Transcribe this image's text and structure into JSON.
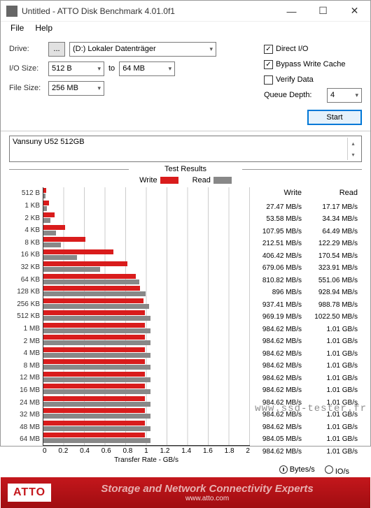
{
  "window": {
    "title": "Untitled - ATTO Disk Benchmark 4.01.0f1"
  },
  "menu": {
    "file": "File",
    "help": "Help"
  },
  "controls": {
    "drive_label": "Drive:",
    "drive_browse": "...",
    "drive_value": "(D:) Lokaler Datenträger",
    "io_label": "I/O Size:",
    "io_from": "512 B",
    "io_to_label": "to",
    "io_to": "64 MB",
    "file_label": "File Size:",
    "file_value": "256 MB",
    "direct_io": "Direct I/O",
    "bypass": "Bypass Write Cache",
    "verify": "Verify Data",
    "queue_label": "Queue Depth:",
    "queue_value": "4",
    "start": "Start"
  },
  "device": "Vansuny U52 512GB",
  "results": {
    "header": "Test Results",
    "legend_write": "Write",
    "legend_read": "Read",
    "col_write": "Write",
    "col_read": "Read",
    "xlabel": "Transfer Rate - GB/s",
    "bytes": "Bytes/s",
    "ios": "IO/s"
  },
  "chart_data": {
    "type": "bar",
    "xlabel": "Transfer Rate - GB/s",
    "xlim": [
      0,
      2
    ],
    "xticks": [
      0,
      0.2,
      0.4,
      0.6,
      0.8,
      1,
      1.2,
      1.4,
      1.6,
      1.8,
      2
    ],
    "categories": [
      "512 B",
      "1 KB",
      "2 KB",
      "4 KB",
      "8 KB",
      "16 KB",
      "32 KB",
      "64 KB",
      "128 KB",
      "256 KB",
      "512 KB",
      "1 MB",
      "2 MB",
      "4 MB",
      "8 MB",
      "12 MB",
      "16 MB",
      "24 MB",
      "32 MB",
      "48 MB",
      "64 MB"
    ],
    "series": [
      {
        "name": "Write",
        "unit": "MB/s",
        "values": [
          27.47,
          53.58,
          107.95,
          212.51,
          406.42,
          679.06,
          810.82,
          896,
          937.41,
          969.19,
          984.62,
          984.62,
          984.62,
          984.62,
          984.62,
          984.62,
          984.62,
          984.62,
          984.62,
          984.05,
          984.62
        ],
        "labels": [
          "27.47 MB/s",
          "53.58 MB/s",
          "107.95 MB/s",
          "212.51 MB/s",
          "406.42 MB/s",
          "679.06 MB/s",
          "810.82 MB/s",
          "896 MB/s",
          "937.41 MB/s",
          "969.19 MB/s",
          "984.62 MB/s",
          "984.62 MB/s",
          "984.62 MB/s",
          "984.62 MB/s",
          "984.62 MB/s",
          "984.62 MB/s",
          "984.62 MB/s",
          "984.62 MB/s",
          "984.62 MB/s",
          "984.05 MB/s",
          "984.62 MB/s"
        ]
      },
      {
        "name": "Read",
        "unit": "MB/s",
        "values": [
          17.17,
          34.34,
          64.49,
          122.29,
          170.54,
          323.91,
          551.06,
          928.94,
          988.78,
          1022.5,
          1034.24,
          1034.24,
          1034.24,
          1034.24,
          1034.24,
          1034.24,
          1034.24,
          1034.24,
          1034.24,
          1034.24,
          1034.24
        ],
        "labels": [
          "17.17 MB/s",
          "34.34 MB/s",
          "64.49 MB/s",
          "122.29 MB/s",
          "170.54 MB/s",
          "323.91 MB/s",
          "551.06 MB/s",
          "928.94 MB/s",
          "988.78 MB/s",
          "1022.50 MB/s",
          "1.01 GB/s",
          "1.01 GB/s",
          "1.01 GB/s",
          "1.01 GB/s",
          "1.01 GB/s",
          "1.01 GB/s",
          "1.01 GB/s",
          "1.01 GB/s",
          "1.01 GB/s",
          "1.01 GB/s",
          "1.01 GB/s"
        ]
      }
    ]
  },
  "footer": {
    "logo": "ATTO",
    "line1": "Storage and Network Connectivity Experts",
    "line2": "www.atto.com"
  },
  "watermark": "www.ssd-tester.fr"
}
